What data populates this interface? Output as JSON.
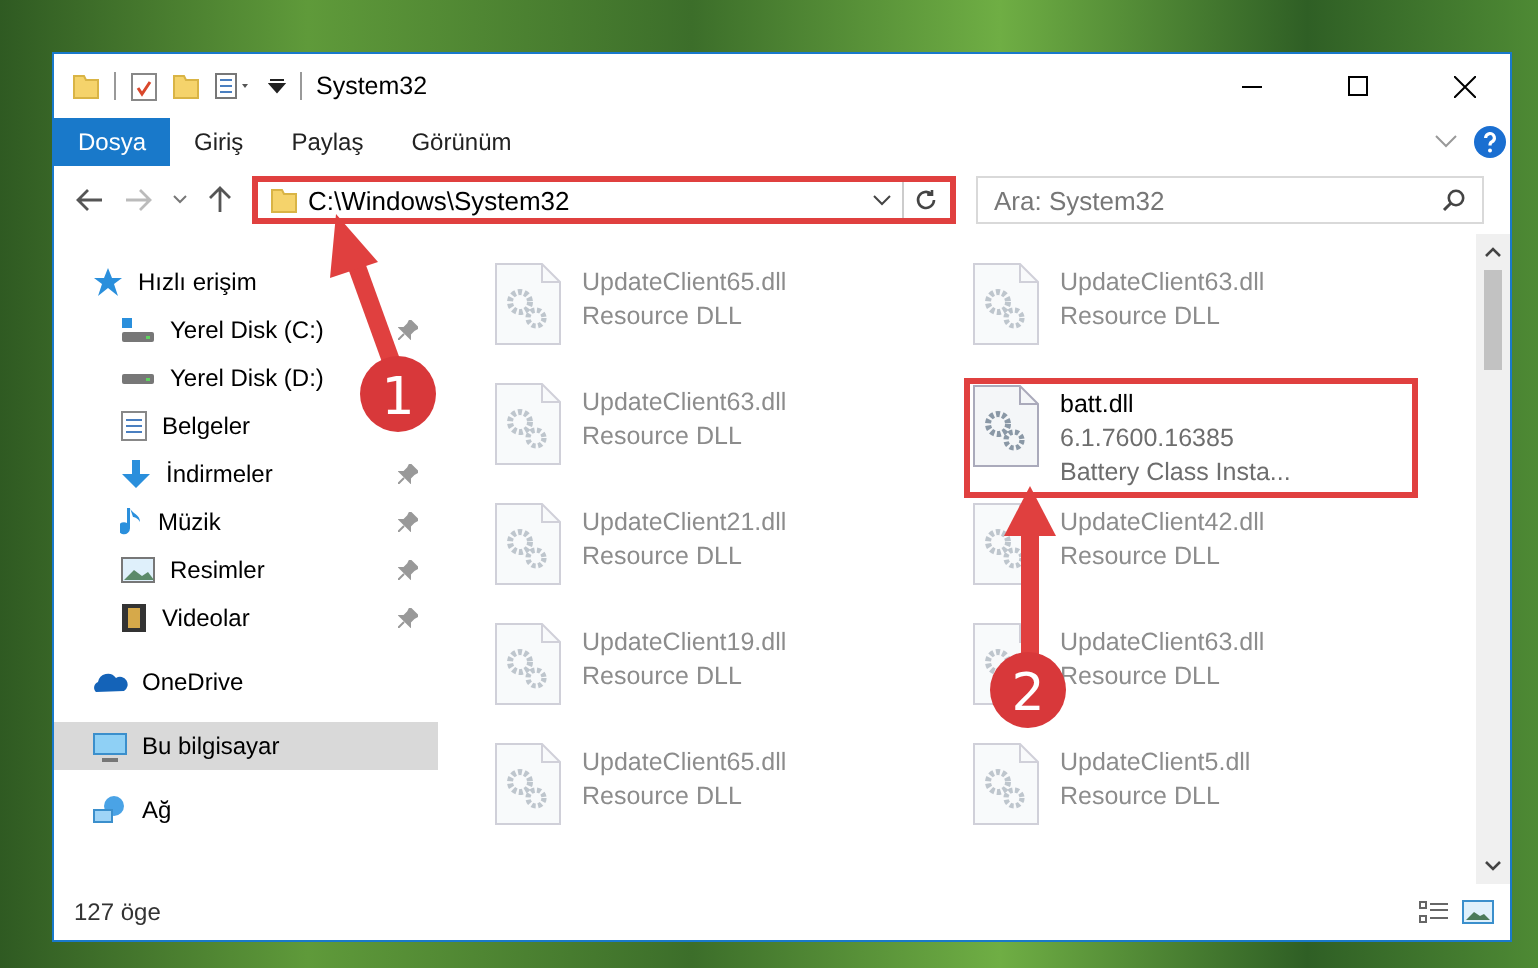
{
  "window": {
    "title": "System32"
  },
  "ribbon_tabs": [
    {
      "label": "Dosya",
      "selected": true
    },
    {
      "label": "Giriş",
      "selected": false
    },
    {
      "label": "Paylaş",
      "selected": false
    },
    {
      "label": "Görünüm",
      "selected": false
    }
  ],
  "address": {
    "path": "C:\\Windows\\System32",
    "highlighted": true
  },
  "search": {
    "placeholder": "Ara: System32"
  },
  "nav": [
    {
      "label": "Hızlı erişim",
      "selected": false,
      "children": [
        {
          "label": "Yerel Disk (C:)",
          "pinned": true,
          "selected": false
        },
        {
          "label": "Yerel Disk (D:)",
          "pinned": false,
          "selected": false
        },
        {
          "label": "Belgeler",
          "pinned": false,
          "selected": false
        },
        {
          "label": "İndirmeler",
          "pinned": true,
          "selected": false
        },
        {
          "label": "Müzik",
          "pinned": true,
          "selected": false
        },
        {
          "label": "Resimler",
          "pinned": true,
          "selected": false
        },
        {
          "label": "Videolar",
          "pinned": true,
          "selected": false
        }
      ]
    },
    {
      "label": "OneDrive",
      "selected": false
    },
    {
      "label": "Bu bilgisayar",
      "selected": true
    },
    {
      "label": "Ağ",
      "selected": false
    }
  ],
  "files": [
    {
      "name": "UpdateClient65.dll",
      "details": [
        "Resource DLL"
      ],
      "blurred": true,
      "highlighted": false
    },
    {
      "name": "UpdateClient63.dll",
      "details": [
        "Resource DLL"
      ],
      "blurred": true,
      "highlighted": false
    },
    {
      "name": "UpdateClient63.dll",
      "details": [
        "Resource DLL"
      ],
      "blurred": true,
      "highlighted": false
    },
    {
      "name": "batt.dll",
      "details": [
        "6.1.7600.16385",
        "Battery Class Insta..."
      ],
      "blurred": false,
      "highlighted": true
    },
    {
      "name": "UpdateClient21.dll",
      "details": [
        "Resource DLL"
      ],
      "blurred": true,
      "highlighted": false
    },
    {
      "name": "UpdateClient42.dll",
      "details": [
        "Resource DLL"
      ],
      "blurred": true,
      "highlighted": false
    },
    {
      "name": "UpdateClient19.dll",
      "details": [
        "Resource DLL"
      ],
      "blurred": true,
      "highlighted": false
    },
    {
      "name": "UpdateClient63.dll",
      "details": [
        "Resource DLL"
      ],
      "blurred": true,
      "highlighted": false
    },
    {
      "name": "UpdateClient65.dll",
      "details": [
        "Resource DLL"
      ],
      "blurred": true,
      "highlighted": false
    },
    {
      "name": "UpdateClient5.dll",
      "details": [
        "Resource DLL"
      ],
      "blurred": true,
      "highlighted": false
    }
  ],
  "status_bar": {
    "item_count": "127 öge"
  },
  "annotations": [
    {
      "label": "1"
    },
    {
      "label": "2"
    }
  ]
}
